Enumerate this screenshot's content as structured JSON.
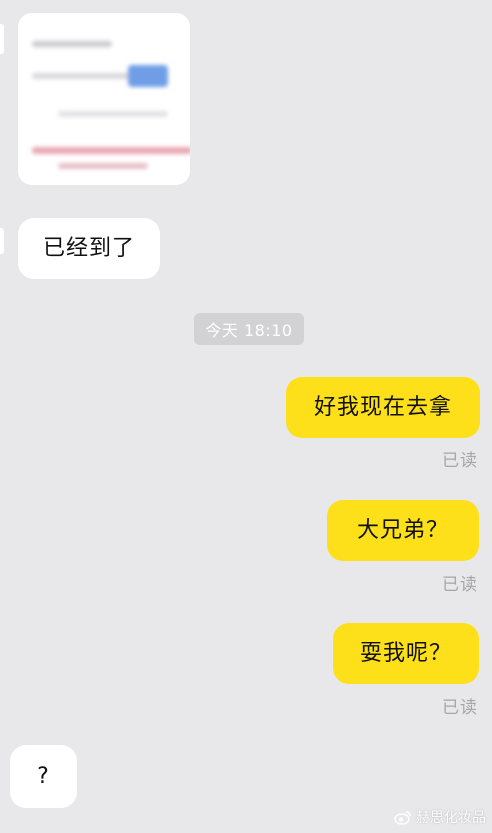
{
  "timestamp": "今天 18:10",
  "messages": {
    "m1": "已经到了",
    "m2": "好我现在去拿",
    "m3": "大兄弟？",
    "m4": "耍我呢？",
    "m5": "?"
  },
  "read_status": {
    "r2": "已读",
    "r3": "已读",
    "r4": "已读"
  },
  "watermark": "赫思化妆品",
  "colors": {
    "background": "#e8e8ea",
    "incoming_bubble": "#ffffff",
    "outgoing_bubble": "#fde01a",
    "timestamp_pill": "#d2d2d4"
  }
}
